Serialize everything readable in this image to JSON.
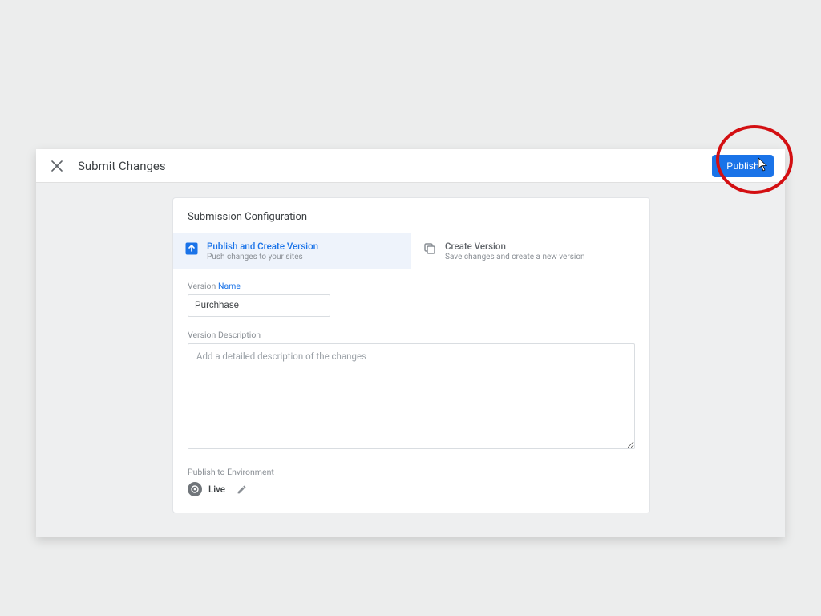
{
  "header": {
    "title": "Submit Changes",
    "publish_label": "Publish"
  },
  "card": {
    "title": "Submission Configuration",
    "options": {
      "publish": {
        "title": "Publish and Create Version",
        "subtitle": "Push changes to your sites"
      },
      "create": {
        "title": "Create Version",
        "subtitle": "Save changes and create a new version"
      }
    },
    "version_name_label_pre": "Version ",
    "version_name_label_em": "Name",
    "version_name_value": "Purchhase",
    "version_desc_label": "Version Description",
    "version_desc_placeholder": "Add a detailed description of the changes",
    "env_label": "Publish to Environment",
    "env_name": "Live"
  },
  "colors": {
    "accent": "#1a73e8",
    "annotation_ring": "#d30f12"
  }
}
